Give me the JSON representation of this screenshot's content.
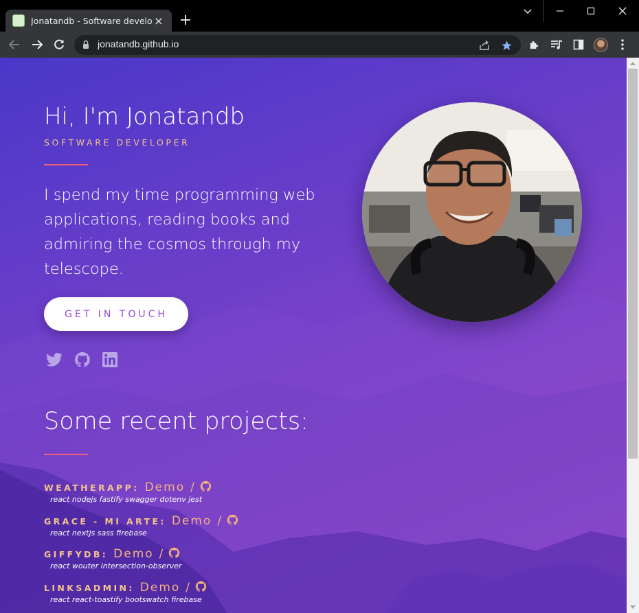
{
  "browser": {
    "tab_title": "Jonatandb - Software developer",
    "url": "jonatandb.github.io"
  },
  "hero": {
    "title": "Hi, I'm Jonatandb",
    "subtitle": "Software developer",
    "text": "I spend my time programming web applications, reading books and admiring the cosmos through my telescope.",
    "cta": "Get in touch"
  },
  "social": [
    "twitter-icon",
    "github-icon",
    "linkedin-icon"
  ],
  "projects": {
    "title": "Some recent projects:",
    "items": [
      {
        "name": "WeatherApp:",
        "demo": "Demo",
        "sep": "/",
        "tags": "react nodejs fastify swagger dotenv jest"
      },
      {
        "name": "Grace - Mi Arte:",
        "demo": "Demo",
        "sep": "/",
        "tags": "react nextjs sass firebase"
      },
      {
        "name": "GiffyDB:",
        "demo": "Demo",
        "sep": "/",
        "tags": "react wouter intersection-observer"
      },
      {
        "name": "LinksAdmin:",
        "demo": "Demo",
        "sep": "/",
        "tags": "react react-toastify bootswatch firebase"
      }
    ]
  },
  "colors": {
    "accent": "#f3c38b",
    "divider": "#f0607a",
    "bg_start": "#4a37c9",
    "bg_end": "#a24ad0"
  }
}
